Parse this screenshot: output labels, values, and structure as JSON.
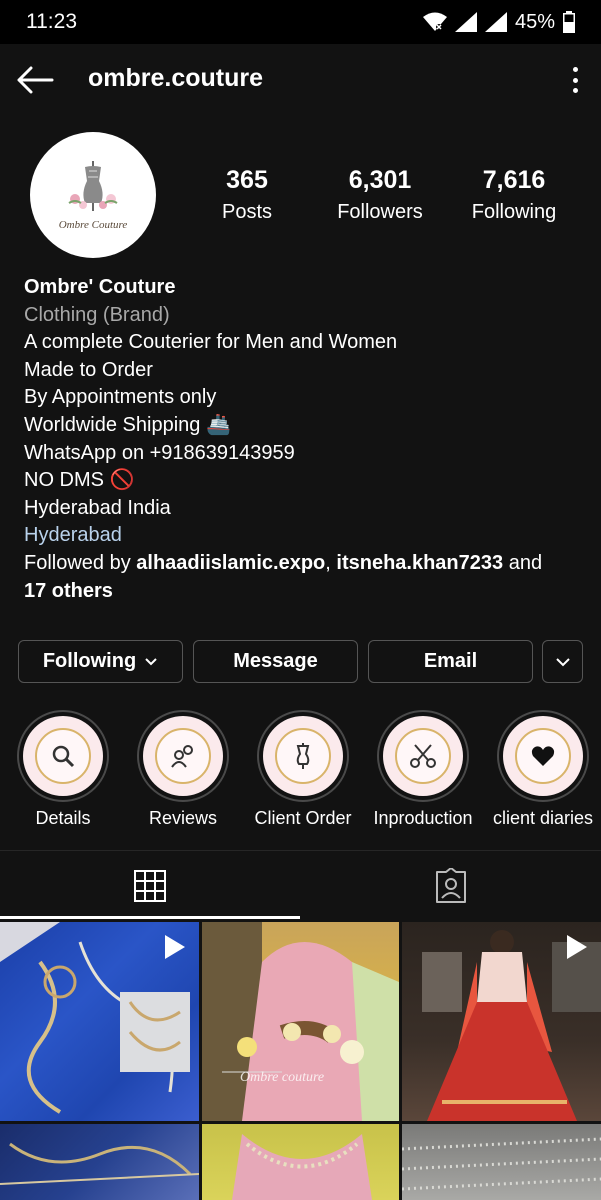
{
  "status_bar": {
    "time": "11:23",
    "battery": "45%"
  },
  "header": {
    "username": "ombre.couture"
  },
  "profile": {
    "avatar_caption": "Ombre Couture",
    "stats": [
      {
        "value": "365",
        "label": "Posts"
      },
      {
        "value": "6,301",
        "label": "Followers"
      },
      {
        "value": "7,616",
        "label": "Following"
      }
    ]
  },
  "bio": {
    "name": "Ombre' Couture",
    "category": "Clothing (Brand)",
    "lines": [
      "A complete Couterier for Men and Women",
      "Made to Order",
      "By Appointments only",
      "Worldwide Shipping 🚢",
      "WhatsApp on +918639143959",
      "NO DMS 🚫",
      "Hyderabad India"
    ],
    "location_link": "Hyderabad",
    "followed_by": {
      "prefix": "Followed by",
      "user1": "alhaadiislamic.expo",
      "sep": ",",
      "user2": "itsneha.khan7233",
      "and": "and",
      "others": "17 others"
    }
  },
  "actions": {
    "following_label": "Following",
    "message_label": "Message",
    "email_label": "Email"
  },
  "highlights": [
    {
      "label": "Details",
      "icon": "magnifier-icon"
    },
    {
      "label": "Reviews",
      "icon": "people-icon"
    },
    {
      "label": "Client Order",
      "icon": "dress-form-icon"
    },
    {
      "label": "Inproduction",
      "icon": "scissors-icon"
    },
    {
      "label": "client diaries",
      "icon": "heart-icon"
    }
  ],
  "tabs": [
    {
      "name": "posts-grid",
      "icon": "grid-icon",
      "active": true
    },
    {
      "name": "tagged",
      "icon": "tagged-person-icon",
      "active": false
    }
  ],
  "posts": [
    {
      "kind": "reel",
      "watermark": ""
    },
    {
      "kind": "photo",
      "watermark": "Ombre couture"
    },
    {
      "kind": "reel",
      "watermark": ""
    },
    {
      "kind": "photo",
      "watermark": ""
    },
    {
      "kind": "photo",
      "watermark": ""
    },
    {
      "kind": "photo",
      "watermark": ""
    }
  ],
  "colors": {
    "background": "#121212",
    "link": "#b9d2ec",
    "muted": "#a8a8a8",
    "highlight_gold": "#d9b46a"
  }
}
